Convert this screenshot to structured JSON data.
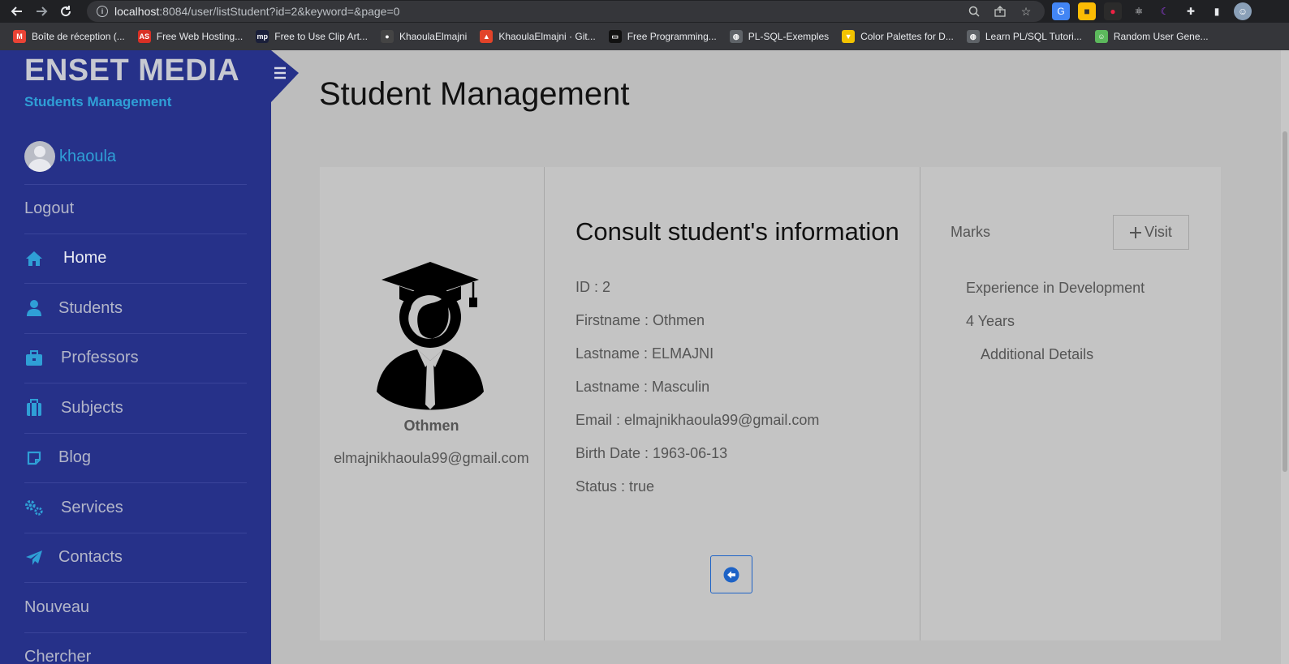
{
  "browser": {
    "url_host": "localhost",
    "url_rest": ":8084/user/listStudent?id=2&keyword=&page=0",
    "bookmarks": [
      {
        "label": "Boîte de réception (...",
        "icon": "gmail-icon",
        "color": "#ea4335",
        "glyph": "M"
      },
      {
        "label": "Free Web Hosting...",
        "icon": "hosting-icon",
        "color": "#d93025",
        "glyph": "AS"
      },
      {
        "label": "Free to Use Clip Art...",
        "icon": "clipart-icon",
        "color": "#1a1f3a",
        "glyph": "mp"
      },
      {
        "label": "KhaoulaElmajni",
        "icon": "github-icon",
        "color": "#444",
        "glyph": "●"
      },
      {
        "label": "KhaoulaElmajni · Git...",
        "icon": "gitlab-icon",
        "color": "#e24329",
        "glyph": "▲"
      },
      {
        "label": "Free Programming...",
        "icon": "programming-icon",
        "color": "#111",
        "glyph": "▭"
      },
      {
        "label": "PL-SQL-Exemples",
        "icon": "globe-icon",
        "color": "#5f6368",
        "glyph": "◍"
      },
      {
        "label": "Color Palettes for D...",
        "icon": "palette-icon",
        "color": "#f2c300",
        "glyph": "▼"
      },
      {
        "label": "Learn PL/SQL Tutori...",
        "icon": "globe-icon",
        "color": "#5f6368",
        "glyph": "◍"
      },
      {
        "label": "Random User Gene...",
        "icon": "randomuser-icon",
        "color": "#5cb85c",
        "glyph": "☺"
      }
    ]
  },
  "sidebar": {
    "brand": "ENSET MEDIA",
    "subtitle": "Students Management",
    "username": "khaoula",
    "items": [
      {
        "label": "Logout",
        "icon": ""
      },
      {
        "label": "Home",
        "icon": "home-icon"
      },
      {
        "label": "Students",
        "icon": "user-icon"
      },
      {
        "label": "Professors",
        "icon": "briefcase-icon"
      },
      {
        "label": "Subjects",
        "icon": "suitcase-icon"
      },
      {
        "label": "Blog",
        "icon": "note-icon"
      },
      {
        "label": "Services",
        "icon": "gears-icon"
      },
      {
        "label": "Contacts",
        "icon": "paper-plane-icon"
      },
      {
        "label": "Nouveau",
        "icon": ""
      },
      {
        "label": "Chercher",
        "icon": ""
      }
    ]
  },
  "main": {
    "title": "Student Management",
    "profile": {
      "name": "Othmen",
      "email": "elmajnikhaoula99@gmail.com"
    },
    "info": {
      "heading": "Consult student's information",
      "lines": [
        "ID : 2",
        "Firstname : Othmen",
        "Lastname : ELMAJNI",
        "Lastname : Masculin",
        "Email : elmajnikhaoula99@gmail.com",
        "Birth Date : 1963-06-13",
        "Status : true"
      ]
    },
    "marks": {
      "label": "Marks",
      "visit_button": "Visit",
      "experience_title": "Experience in Development",
      "experience_value": "4 Years",
      "additional": "Additional Details"
    }
  }
}
